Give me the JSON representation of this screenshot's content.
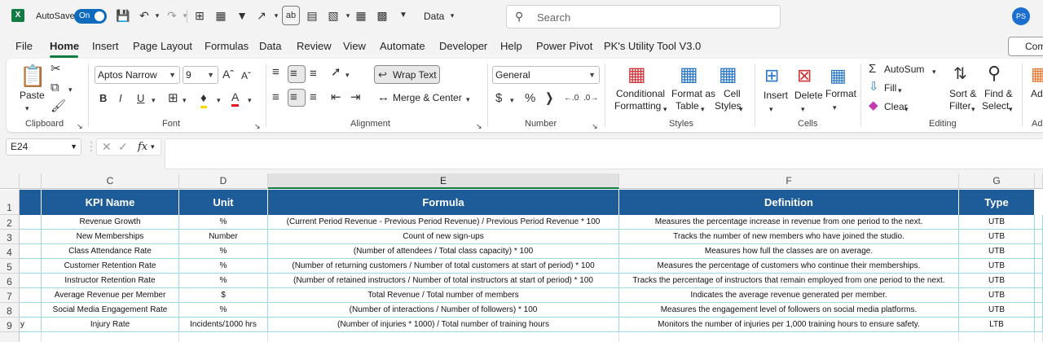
{
  "titlebar": {
    "autosave_label": "AutoSave",
    "autosave_state": "On",
    "file_name": "Data",
    "search_placeholder": "Search",
    "user_initials": "PS"
  },
  "tabs": [
    "File",
    "Home",
    "Insert",
    "Page Layout",
    "Formulas",
    "Data",
    "Review",
    "View",
    "Automate",
    "Developer",
    "Help",
    "Power Pivot",
    "PK's Utility Tool V3.0"
  ],
  "active_tab": "Home",
  "comments_label": "Com",
  "ribbon": {
    "clipboard": {
      "paste": "Paste",
      "label": "Clipboard"
    },
    "font": {
      "name": "Aptos Narrow",
      "size": "9",
      "label": "Font"
    },
    "alignment": {
      "wrap_text": "Wrap Text",
      "merge_center": "Merge & Center",
      "label": "Alignment"
    },
    "number": {
      "format": "General",
      "label": "Number"
    },
    "styles": {
      "conditional_1": "Conditional",
      "conditional_2": "Formatting",
      "format_table_1": "Format as",
      "format_table_2": "Table",
      "cell_styles_1": "Cell",
      "cell_styles_2": "Styles",
      "label": "Styles"
    },
    "cells": {
      "insert": "Insert",
      "delete": "Delete",
      "format": "Format",
      "label": "Cells"
    },
    "editing": {
      "autosum": "AutoSum",
      "fill": "Fill",
      "clear": "Clear",
      "sort_1": "Sort &",
      "sort_2": "Filter",
      "find_1": "Find &",
      "find_2": "Select",
      "label": "Editing"
    },
    "addins": {
      "label_1": "Add",
      "label_2": "Ad"
    }
  },
  "formula_bar": {
    "name_box": "E24",
    "fx": "fx",
    "content": ""
  },
  "columns": [
    "C",
    "D",
    "E",
    "F",
    "G"
  ],
  "rows": [
    "1",
    "2",
    "3",
    "4",
    "5",
    "6",
    "7",
    "8",
    "9"
  ],
  "table": {
    "headers": [
      "KPI Name",
      "Unit",
      "Formula",
      "Definition",
      "Type"
    ],
    "rows": [
      [
        "Revenue Growth",
        "%",
        "(Current Period Revenue - Previous Period Revenue) / Previous Period Revenue * 100",
        "Measures the percentage increase in revenue from one period to the next.",
        "UTB"
      ],
      [
        "New Memberships",
        "Number",
        "Count of new sign-ups",
        "Tracks the number of new members who have joined the studio.",
        "UTB"
      ],
      [
        "Class Attendance Rate",
        "%",
        "(Number of attendees / Total class capacity) * 100",
        "Measures how full the classes are on average.",
        "UTB"
      ],
      [
        "Customer Retention Rate",
        "%",
        "(Number of returning customers / Number of total customers at start of period) * 100",
        "Measures the percentage of customers who continue their memberships.",
        "UTB"
      ],
      [
        "Instructor Retention Rate",
        "%",
        "(Number of retained instructors / Number of total instructors at start of period) * 100",
        "Tracks the percentage of instructors that remain employed from one period to the next.",
        "UTB"
      ],
      [
        "Average Revenue per Member",
        "$",
        "Total Revenue / Total number of members",
        "Indicates the average revenue generated per member.",
        "UTB"
      ],
      [
        "Social Media Engagement Rate",
        "%",
        "(Number of interactions / Number of followers) * 100",
        "Measures the engagement level of followers on social media platforms.",
        "UTB"
      ],
      [
        "Injury Rate",
        "Incidents/1000 hrs",
        "(Number of injuries * 1000) / Total number of training hours",
        "Monitors the number of injuries per 1,000 training hours to ensure safety.",
        "LTB"
      ]
    ],
    "row9_fragment": "y"
  },
  "colors": {
    "header_fill": "#1e5b99",
    "accent": "#107c41",
    "grid": "#9cd7e8"
  }
}
